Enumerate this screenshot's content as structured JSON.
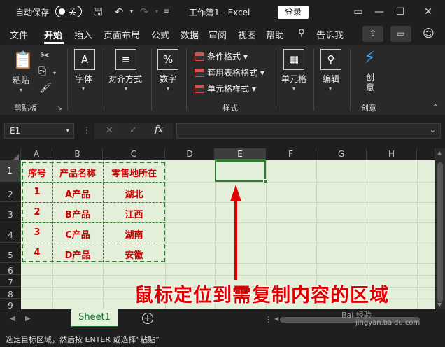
{
  "titlebar": {
    "autosave_label": "自动保存",
    "autosave_state": "关",
    "doc_title": "工作簿1 - Excel",
    "login_label": "登录"
  },
  "menu": {
    "items": [
      "文件",
      "开始",
      "插入",
      "页面布局",
      "公式",
      "数据",
      "审阅",
      "视图",
      "帮助",
      "告诉我"
    ],
    "active": "开始"
  },
  "ribbon": {
    "clipboard": {
      "paste": "粘贴",
      "group": "剪贴板"
    },
    "font": {
      "label": "字体"
    },
    "align": {
      "label": "对齐方式"
    },
    "number": {
      "label": "数字"
    },
    "styles": {
      "cond": "条件格式",
      "table": "套用表格格式",
      "cell": "单元格样式",
      "group": "样式"
    },
    "cells": {
      "label": "单元格"
    },
    "editing": {
      "label": "编辑"
    },
    "creative": {
      "label": "创意",
      "group": "创意"
    }
  },
  "formula_bar": {
    "name_box": "E1",
    "fx": "fx"
  },
  "grid": {
    "columns": [
      "A",
      "B",
      "C",
      "D",
      "E",
      "F",
      "G",
      "H"
    ],
    "rows": [
      "1",
      "2",
      "3",
      "4",
      "5",
      "6",
      "7",
      "8",
      "9"
    ],
    "selected_cell": "E1",
    "table": {
      "header": [
        "序号",
        "产品名称",
        "零售地所在"
      ],
      "rows": [
        [
          "1",
          "A产品",
          "湖北"
        ],
        [
          "2",
          "B产品",
          "江西"
        ],
        [
          "3",
          "C产品",
          "湖南"
        ],
        [
          "4",
          "D产品",
          "安徽"
        ]
      ]
    }
  },
  "annotation": "鼠标定位到需复制内容的区域",
  "tabs": {
    "sheet": "Sheet1"
  },
  "status": {
    "text": "选定目标区域，然后按 ENTER 或选择“粘贴”"
  },
  "watermark": {
    "line1": "Bai 经验",
    "line2": "jingyan.baidu.com"
  },
  "colors": {
    "sheet_bg": "#e3efd9",
    "accent_green": "#2e7d32",
    "text_red": "#d00000"
  }
}
